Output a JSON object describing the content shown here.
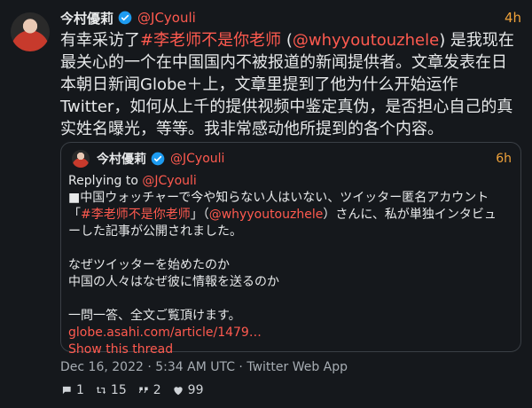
{
  "tweet": {
    "name": "今村優莉",
    "handle": "@JCyouli",
    "time": "4h",
    "text_before": "有幸采访了",
    "hashtag": "#李老师不是你老师",
    "text_mid": " (",
    "mention": "@whyyoutouzhele",
    "text_after": ") 是我现在最关心的一个在中国国内不被报道的新闻提供者。文章发表在日本朝日新闻Globe＋上，文章里提到了他为什么开始运作Twitter，如何从上千的提供视频中鉴定真伪，是否担心自己的真实姓名曝光，等等。我非常感动他所提到的各个内容。",
    "meta": "Dec 16, 2022 · 5:34 AM UTC · Twitter Web App",
    "counts": {
      "comments": "1",
      "retweets": "15",
      "quotes": "2",
      "likes": "99"
    }
  },
  "quote": {
    "name": "今村優莉",
    "handle": "@JCyouli",
    "time": "6h",
    "replying_label": "Replying to ",
    "replying_handle": "@JCyouli",
    "line1_before": "■中国ウォッチャーで今や知らない人はいない、ツイッター匿名アカウント「",
    "hashtag": "#李老师不是你老师",
    "line1_mid": "」（",
    "mention": "@whyyoutouzhele",
    "line1_after": "）さんに、私が単独インタビューした記事が公開されました。",
    "line2": "なぜツイッターを始めたのか",
    "line3": "中国の人々はなぜ彼に情報を送るのか",
    "line4": "一問一答、全文ご覧頂けます。",
    "url": "globe.asahi.com/article/1479…",
    "show_thread": "Show this thread"
  },
  "colors": {
    "background": "#15181c",
    "accent": "#ff5a4f",
    "time": "#f0a23a",
    "verified": "#1d9bf0"
  },
  "icons": {
    "verified": "verified-badge-icon",
    "comment": "comment-icon",
    "retweet": "retweet-icon",
    "quote": "quote-icon",
    "like": "heart-icon"
  }
}
